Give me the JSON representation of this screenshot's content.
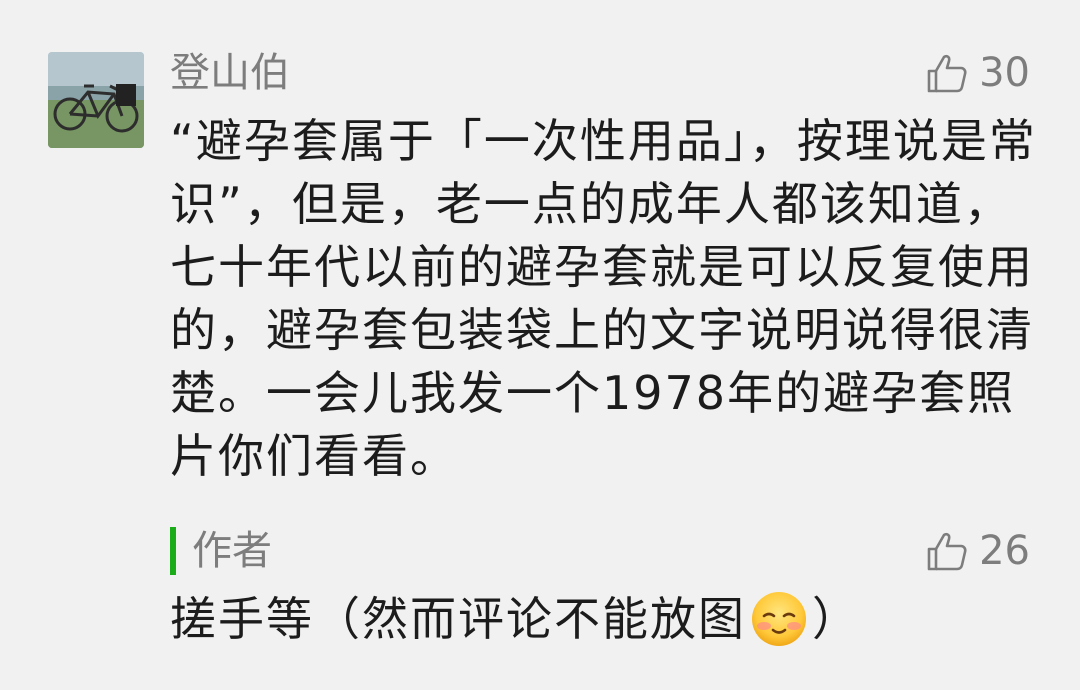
{
  "comment": {
    "user": "登山伯",
    "likes": "30",
    "text": "“避孕套属于「一次性用品」，按理说是常识”，但是，老一点的成年人都该知道，七十年代以前的避孕套就是可以反复使用的，避孕套包装袋上的文字说明说得很清楚。一会儿我发一个1978年的避孕套照片你们看看。"
  },
  "reply": {
    "author": "作者",
    "likes": "26",
    "text_before": "搓手等（然而评论不能放图",
    "text_after": "）",
    "emoji": "blushing-smile-emoji"
  },
  "icons": {
    "like": "thumbs-up-icon",
    "avatar": "bicycle-avatar"
  },
  "colors": {
    "background": "#f1f1f1",
    "accent": "#1aad19",
    "secondary_text": "#7d7d7d",
    "primary_text": "#1c1c1c"
  }
}
